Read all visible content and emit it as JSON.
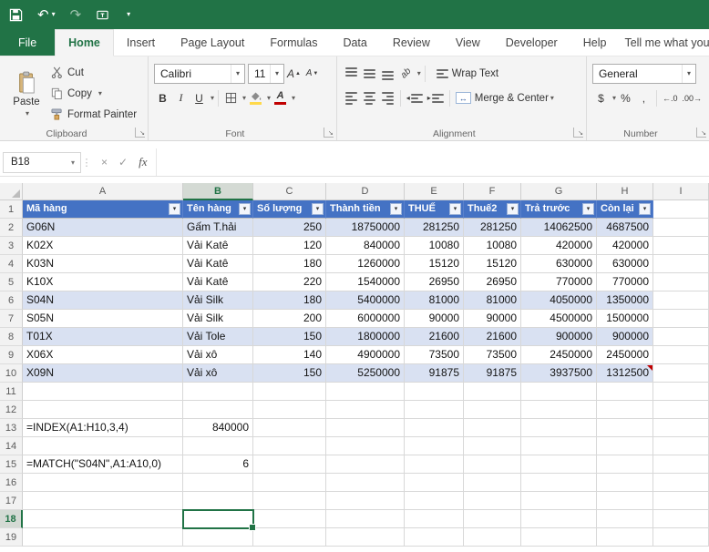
{
  "icons": {
    "dropdown": "▾",
    "undo": "↶",
    "redo": "↷",
    "dialog_launcher": "↘",
    "close": "×",
    "check": "✓",
    "grip": "⋮",
    "bold": "B",
    "italic": "I",
    "underline": "U",
    "font_letter": "A",
    "up_arrow": "▲",
    "down_arrow": "▼",
    "left_right_arrow": "↔",
    "orientation": "ab",
    "indent_left": "◂",
    "indent_right": "▸",
    "dollar": "$",
    "percent": "%",
    "comma": ",",
    "increase_decimal": "←.0",
    "decrease_decimal": ".00→"
  },
  "ribbon": {
    "tabs": [
      {
        "label": "File",
        "style": "file"
      },
      {
        "label": "Home",
        "style": "active"
      },
      {
        "label": "Insert"
      },
      {
        "label": "Page Layout"
      },
      {
        "label": "Formulas"
      },
      {
        "label": "Data"
      },
      {
        "label": "Review"
      },
      {
        "label": "View"
      },
      {
        "label": "Developer"
      },
      {
        "label": "Help"
      }
    ],
    "tell_me": "Tell me what you",
    "clipboard": {
      "label": "Clipboard",
      "paste": "Paste",
      "cut": "Cut",
      "copy": "Copy",
      "format_painter": "Format Painter"
    },
    "font": {
      "label": "Font",
      "name": "Calibri",
      "size": "11"
    },
    "alignment": {
      "label": "Alignment",
      "wrap_text": "Wrap Text",
      "merge_center": "Merge & Center"
    },
    "number": {
      "label": "Number",
      "format": "General"
    }
  },
  "formula_bar": {
    "name_box": "B18",
    "fx": "fx",
    "formula": ""
  },
  "sheet": {
    "columns": [
      "A",
      "B",
      "C",
      "D",
      "E",
      "F",
      "G",
      "H",
      "I"
    ],
    "row_count": 19,
    "selected": {
      "cell": "B18",
      "col": "B",
      "row": 18
    },
    "accent": "#217346",
    "table": {
      "headers": [
        "Mã hàng",
        "Tên hàng",
        "Số lượng",
        "Thành tiền",
        "THUẾ",
        "Thuế2",
        "Trả trước",
        "Còn lại"
      ],
      "header_fill": "#4472c4",
      "band_fill": "#d9e1f2",
      "banded_rows": [
        2,
        6,
        8,
        10
      ],
      "rows": [
        [
          "G06N",
          "Gấm T.hải",
          "250",
          "18750000",
          "281250",
          "281250",
          "14062500",
          "4687500"
        ],
        [
          "K02X",
          "Vải Katê",
          "120",
          "840000",
          "10080",
          "10080",
          "420000",
          "420000"
        ],
        [
          "K03N",
          "Vải Katê",
          "180",
          "1260000",
          "15120",
          "15120",
          "630000",
          "630000"
        ],
        [
          "K10X",
          "Vải Katê",
          "220",
          "1540000",
          "26950",
          "26950",
          "770000",
          "770000"
        ],
        [
          "S04N",
          "Vải Silk",
          "180",
          "5400000",
          "81000",
          "81000",
          "4050000",
          "1350000"
        ],
        [
          "S05N",
          "Vải Silk",
          "200",
          "6000000",
          "90000",
          "90000",
          "4500000",
          "1500000"
        ],
        [
          "T01X",
          "Vải Tole",
          "150",
          "1800000",
          "21600",
          "21600",
          "900000",
          "900000"
        ],
        [
          "X06X",
          "Vải xô",
          "140",
          "4900000",
          "73500",
          "73500",
          "2450000",
          "2450000"
        ],
        [
          "X09N",
          "Vải xô",
          "150",
          "5250000",
          "91875",
          "91875",
          "3937500",
          "1312500"
        ]
      ]
    },
    "extra_cells": [
      {
        "row": 13,
        "col": "A",
        "text": "=INDEX(A1:H10,3,4)",
        "align": "left"
      },
      {
        "row": 13,
        "col": "B",
        "text": "840000",
        "align": "right"
      },
      {
        "row": 15,
        "col": "A",
        "text": "=MATCH(\"S04N\",A1:A10,0)",
        "align": "left"
      },
      {
        "row": 15,
        "col": "B",
        "text": "6",
        "align": "right"
      }
    ],
    "comment_marker": {
      "row": 10,
      "col": "H"
    }
  }
}
